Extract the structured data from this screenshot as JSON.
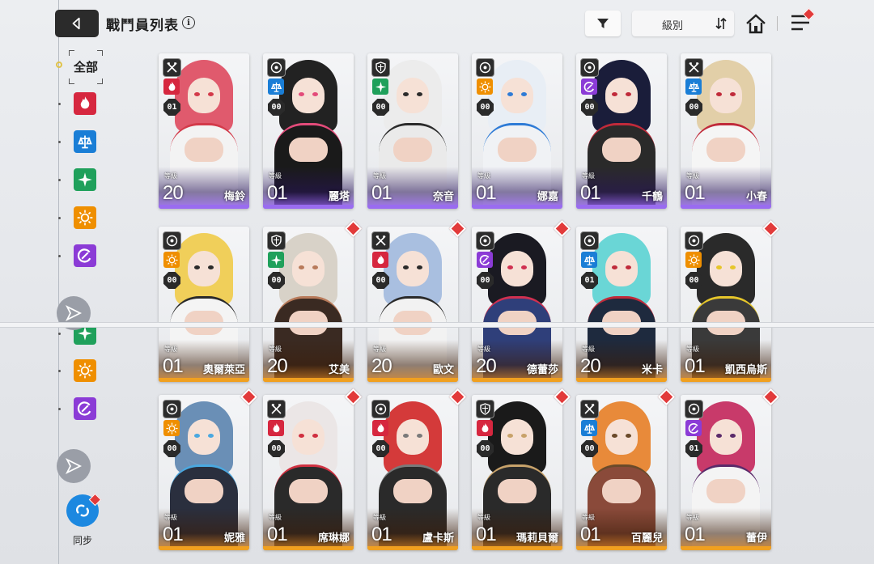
{
  "header": {
    "title": "戰鬥員列表",
    "info_icon": "i",
    "sort_label": "級別",
    "sort_icon": "sort-icon",
    "filter_icon": "filter-icon",
    "home_icon": "home-icon",
    "menu_icon": "menu-icon"
  },
  "sidebar": {
    "all_label": "全部",
    "elements_top": [
      "fire",
      "water",
      "wind",
      "electric",
      "iron"
    ],
    "elements_bottom": [
      "wind",
      "electric",
      "iron"
    ],
    "sync_label": "同步"
  },
  "colors": {
    "fire": "#d6273f",
    "water": "#1a7ed6",
    "wind": "#1fa05b",
    "electric": "#ef8f00",
    "iron": "#8b3bd6",
    "rarity_ssr": "#f0a020",
    "rarity_sr": "#9a6cf0"
  },
  "level_label": "等級",
  "cards": [
    {
      "name": "梅鈴",
      "level": "20",
      "burst": "01",
      "class": "attacker",
      "element": "fire",
      "rarity": "sr",
      "alert": false,
      "hair": "#e05a6d",
      "outfit": "#f3f3f3",
      "accent": "#d33a4a"
    },
    {
      "name": "麗塔",
      "level": "01",
      "burst": "00",
      "class": "supporter",
      "element": "water",
      "rarity": "sr",
      "alert": false,
      "hair": "#222",
      "outfit": "#1a1a1a",
      "accent": "#e34b7a"
    },
    {
      "name": "奈音",
      "level": "01",
      "burst": "00",
      "class": "defender",
      "element": "wind",
      "rarity": "sr",
      "alert": false,
      "hair": "#ececec",
      "outfit": "#eaeaea",
      "accent": "#2b2b2b"
    },
    {
      "name": "娜嘉",
      "level": "01",
      "burst": "00",
      "class": "supporter",
      "element": "electric",
      "rarity": "sr",
      "alert": false,
      "hair": "#e8eef5",
      "outfit": "#f0f2f5",
      "accent": "#2e7bd6"
    },
    {
      "name": "千鶴",
      "level": "01",
      "burst": "00",
      "class": "supporter",
      "element": "iron",
      "rarity": "sr",
      "alert": false,
      "hair": "#1a1d3a",
      "outfit": "#2a2a2a",
      "accent": "#c02a3a"
    },
    {
      "name": "小春",
      "level": "01",
      "burst": "00",
      "class": "attacker",
      "element": "water",
      "rarity": "sr",
      "alert": false,
      "hair": "#e2cfa8",
      "outfit": "#f5f5f5",
      "accent": "#c02a3a"
    },
    {
      "name": "奧爾萊亞",
      "level": "01",
      "burst": "00",
      "class": "supporter",
      "element": "electric",
      "rarity": "ssr",
      "alert": false,
      "hair": "#f0cf5a",
      "outfit": "#f4f4f4",
      "accent": "#2a2a2a"
    },
    {
      "name": "艾美",
      "level": "20",
      "burst": "00",
      "class": "defender",
      "element": "wind",
      "rarity": "ssr",
      "alert": true,
      "hair": "#d8d2c8",
      "outfit": "#3a2a22",
      "accent": "#b87a5a"
    },
    {
      "name": "歐文",
      "level": "20",
      "burst": "00",
      "class": "attacker",
      "element": "fire",
      "rarity": "ssr",
      "alert": true,
      "hair": "#a9bfe0",
      "outfit": "#f2f2f2",
      "accent": "#2a2a2a"
    },
    {
      "name": "德蕾莎",
      "level": "20",
      "burst": "00",
      "class": "supporter",
      "element": "iron",
      "rarity": "ssr",
      "alert": true,
      "hair": "#1a1a22",
      "outfit": "#2f3f7a",
      "accent": "#d03050"
    },
    {
      "name": "米卡",
      "level": "20",
      "burst": "01",
      "class": "supporter",
      "element": "water",
      "rarity": "ssr",
      "alert": false,
      "hair": "#6ad6d6",
      "outfit": "#1e2a3e",
      "accent": "#c02a3a"
    },
    {
      "name": "凱西烏斯",
      "level": "01",
      "burst": "00",
      "class": "supporter",
      "element": "electric",
      "rarity": "ssr",
      "alert": true,
      "hair": "#2a2a2a",
      "outfit": "#3a3a3a",
      "accent": "#e6c62a"
    },
    {
      "name": "妮雅",
      "level": "01",
      "burst": "00",
      "class": "supporter",
      "element": "electric",
      "rarity": "ssr",
      "alert": true,
      "hair": "#6a8fb6",
      "outfit": "#2a2f3e",
      "accent": "#4aa8e0"
    },
    {
      "name": "席琳娜",
      "level": "01",
      "burst": "00",
      "class": "attacker",
      "element": "fire",
      "rarity": "ssr",
      "alert": true,
      "hair": "#ebe6e6",
      "outfit": "#2a2a2a",
      "accent": "#d03040"
    },
    {
      "name": "盧卡斯",
      "level": "01",
      "burst": "00",
      "class": "supporter",
      "element": "fire",
      "rarity": "ssr",
      "alert": true,
      "hair": "#d43a3a",
      "outfit": "#2a2a2a",
      "accent": "#7a7a7a"
    },
    {
      "name": "瑪莉貝爾",
      "level": "01",
      "burst": "00",
      "class": "defender",
      "element": "fire",
      "rarity": "ssr",
      "alert": true,
      "hair": "#1a1a1a",
      "outfit": "#2a2a2a",
      "accent": "#c8a26a"
    },
    {
      "name": "百麗兒",
      "level": "01",
      "burst": "00",
      "class": "attacker",
      "element": "water",
      "rarity": "ssr",
      "alert": true,
      "hair": "#e88a3a",
      "outfit": "#8a4a3a",
      "accent": "#6a4a2a"
    },
    {
      "name": "蕾伊",
      "level": "01",
      "burst": "01",
      "class": "supporter",
      "element": "iron",
      "rarity": "ssr",
      "alert": true,
      "hair": "#c83a6a",
      "outfit": "#f4f4f4",
      "accent": "#5a2a6a"
    }
  ]
}
